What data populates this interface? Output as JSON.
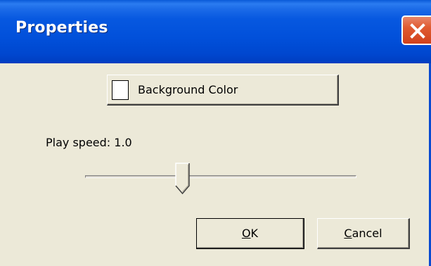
{
  "window": {
    "title": "Properties",
    "title_bar_color": "#0054e3",
    "close_button_color": "#e05a30",
    "client_color": "#ece9d8"
  },
  "background_color_button": {
    "label": "Background Color",
    "swatch_color": "#ffffff"
  },
  "play_speed": {
    "label": "Play speed: 1.0",
    "slider_fraction": 0.36
  },
  "buttons": {
    "ok": {
      "mnemonic": "O",
      "rest": "K"
    },
    "cancel": {
      "mnemonic": "C",
      "rest": "ancel"
    }
  },
  "icons": {
    "close": "close-icon",
    "slider_thumb": "slider-thumb-icon"
  }
}
